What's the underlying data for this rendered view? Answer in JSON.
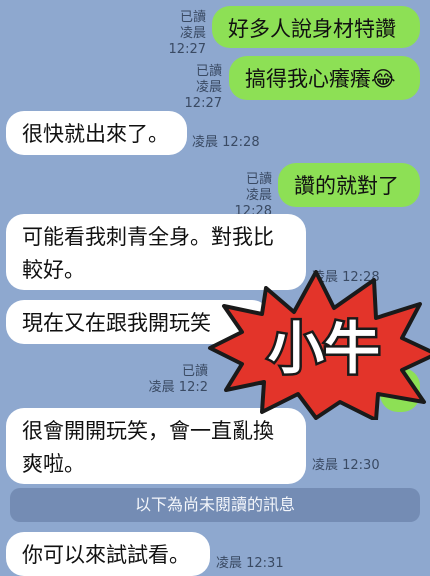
{
  "messages": [
    {
      "dir": "out",
      "text": "好多人說身材特讚",
      "read": "已讀",
      "time": "凌晨 12:27"
    },
    {
      "dir": "out",
      "text": "搞得我心癢癢😂",
      "read": "已讀",
      "time": "凌晨 12:27"
    },
    {
      "dir": "in",
      "text": "很快就出來了。",
      "time": "凌晨 12:28"
    },
    {
      "dir": "out",
      "text": "讚的就對了",
      "read": "已讀",
      "time": "凌晨 12:28"
    },
    {
      "dir": "in",
      "text": "可能看我刺青全身。對我比\n較好。",
      "time": "凌晨 12:28"
    },
    {
      "dir": "in",
      "text": "現在又在跟我開玩笑",
      "time": ""
    },
    {
      "dir": "out",
      "text": "",
      "read": "已讀",
      "time": "凌晨 12:2"
    },
    {
      "dir": "in",
      "text": "很會開開玩笑，會一直亂換\n爽啦。",
      "time": "凌晨 12:30"
    },
    {
      "dir": "in",
      "text": "你可以來試試看。",
      "time": "凌晨 12:31"
    }
  ],
  "divider": "以下為尚未閱讀的訊息",
  "sticker": {
    "text": "小牛",
    "color": "#e3342a"
  }
}
